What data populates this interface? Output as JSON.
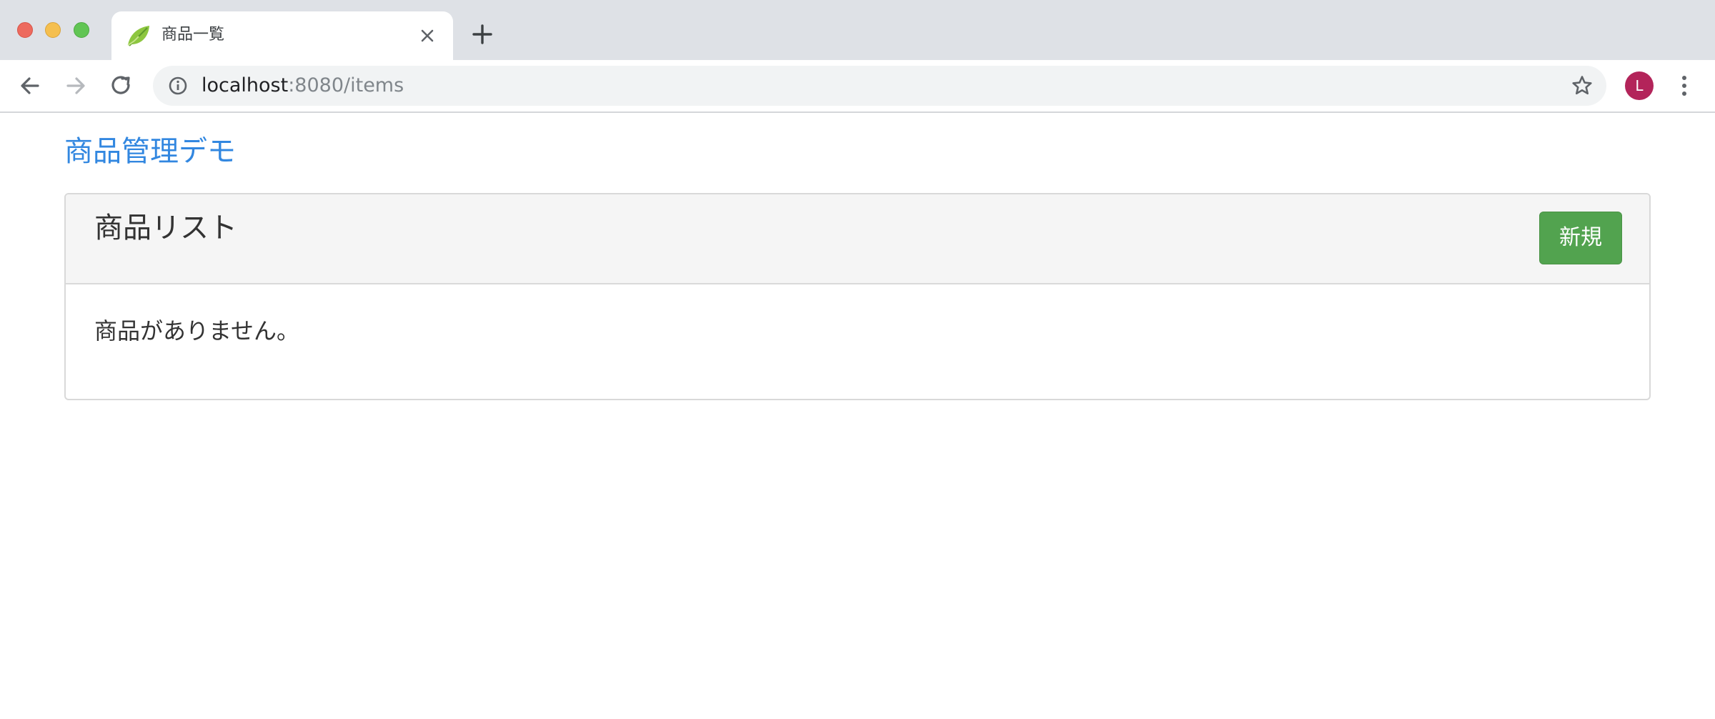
{
  "browser": {
    "tab": {
      "title": "商品一覧",
      "favicon": "spring-leaf-icon"
    },
    "address_bar": {
      "host": "localhost",
      "path": ":8080/items"
    },
    "profile_initial": "L",
    "colors": {
      "tabstrip": "#dee1e6",
      "omnibox": "#f1f3f4",
      "avatar": "#b3245a"
    }
  },
  "page": {
    "brand": "商品管理デモ",
    "card": {
      "title": "商品リスト",
      "new_button_label": "新規",
      "empty_message": "商品がありません。"
    },
    "colors": {
      "brand_link": "#3287e0",
      "new_button": "#52a34f",
      "card_header": "#f5f5f5"
    }
  }
}
